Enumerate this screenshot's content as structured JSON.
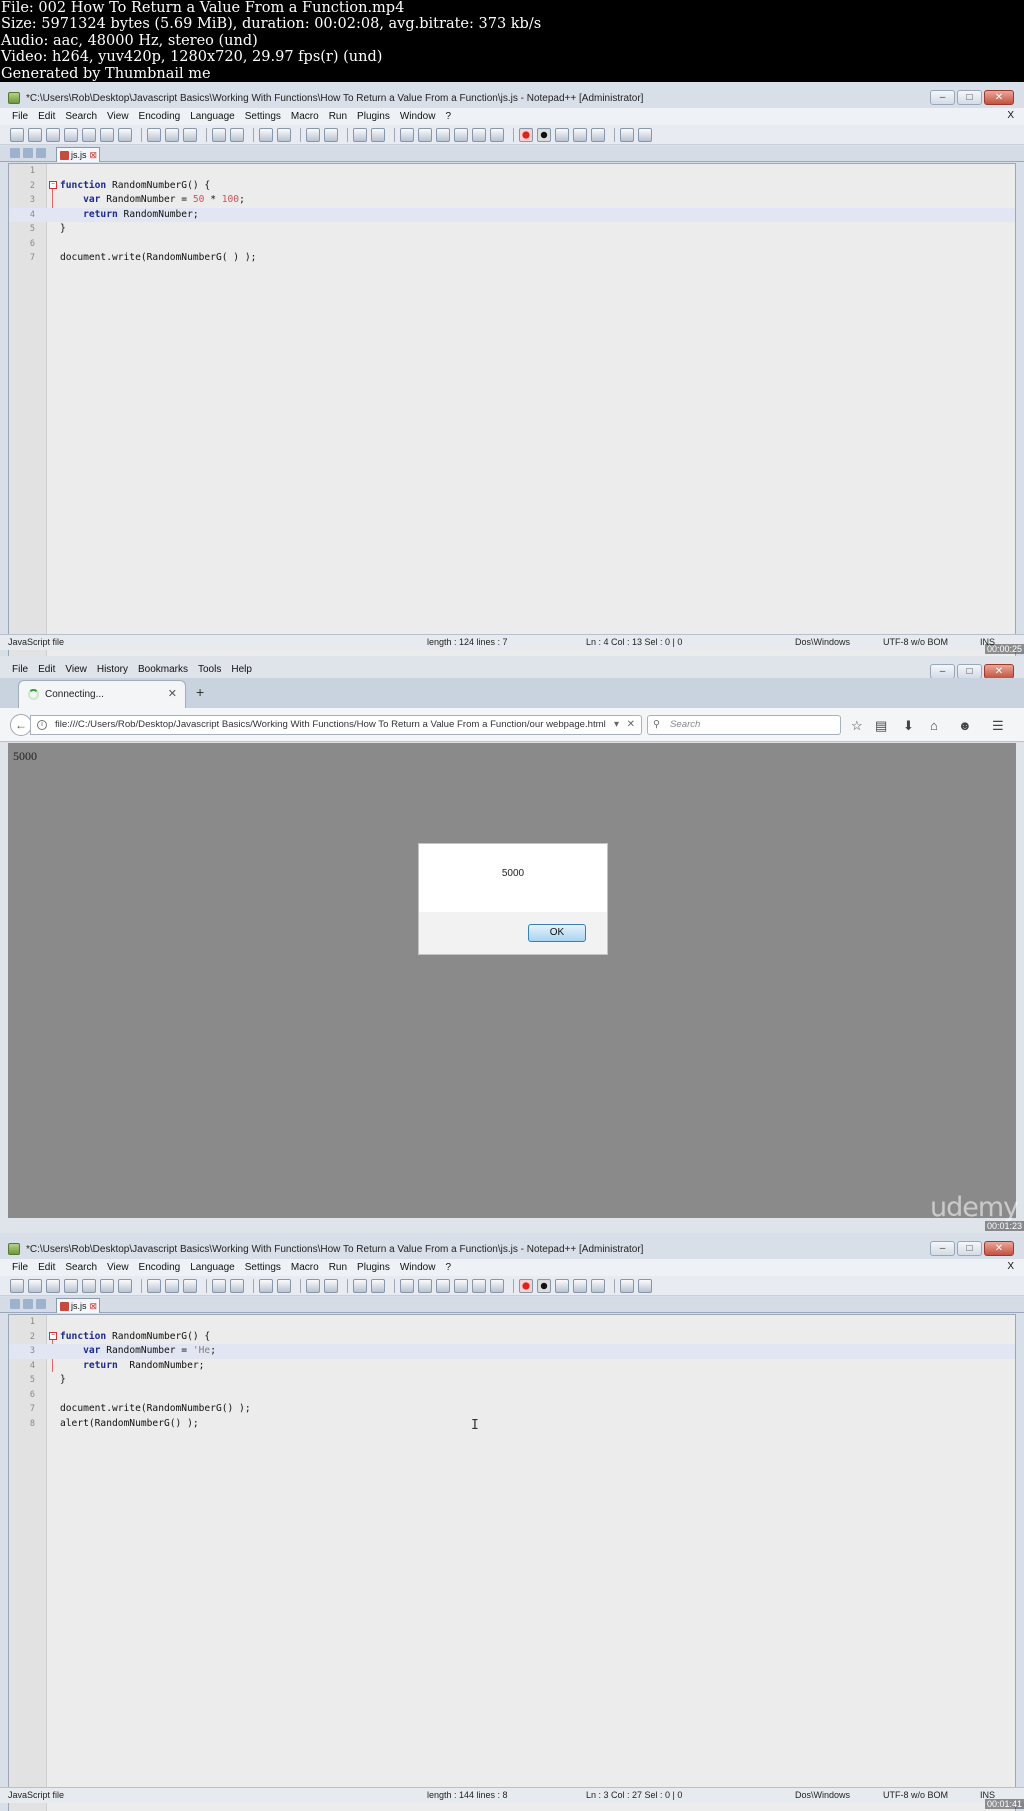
{
  "meta": {
    "lines": [
      "File: 002 How To Return a Value From a Function.mp4",
      "Size: 5971324 bytes (5.69 MiB), duration: 00:02:08, avg.bitrate: 373 kb/s",
      "Audio: aac, 48000 Hz, stereo (und)",
      "Video: h264, yuv420p, 1280x720, 29.97 fps(r) (und)",
      "Generated by Thumbnail me"
    ]
  },
  "frame1": {
    "title": "*C:\\Users\\Rob\\Desktop\\Javascript Basics\\Working With Functions\\How To Return a Value From a Function\\js.js - Notepad++ [Administrator]",
    "menu": [
      "File",
      "Edit",
      "Search",
      "View",
      "Encoding",
      "Language",
      "Settings",
      "Macro",
      "Run",
      "Plugins",
      "Window",
      "?"
    ],
    "menu_close": "X",
    "tab_label": "js.js",
    "code": {
      "l2a": "function",
      "l2b": " RandomNumberG() {",
      "l3a": "var",
      "l3b": " RandomNumber = ",
      "l3c": "50",
      "l3d": " * ",
      "l3e": "100",
      "l3f": ";",
      "l4a": "return",
      "l4b": " RandomNumber;",
      "l5": "}",
      "l7": "document.write(RandomNumberG( ) );"
    },
    "status": {
      "type": "JavaScript file",
      "length": "length : 124    lines : 7",
      "pos": "Ln : 4    Col : 13    Sel : 0 | 0",
      "eol": "Dos\\Windows",
      "enc": "UTF-8 w/o BOM",
      "ins": "INS"
    },
    "timestamp": "00:00:25"
  },
  "frame2": {
    "menu": [
      "File",
      "Edit",
      "View",
      "History",
      "Bookmarks",
      "Tools",
      "Help"
    ],
    "tab_label": "Connecting...",
    "tab_close": "✕",
    "new_tab": "+",
    "url": "file:///C:/Users/Rob/Desktop/Javascript Basics/Working With Functions/How To Return a Value From a Function/our webpage.html",
    "search_placeholder": "Search",
    "page_text": "5000",
    "dialog_message": "5000",
    "dialog_ok": "OK",
    "watermark": "udemy",
    "timestamp": "00:01:23"
  },
  "frame3": {
    "title": "*C:\\Users\\Rob\\Desktop\\Javascript Basics\\Working With Functions\\How To Return a Value From a Function\\js.js - Notepad++ [Administrator]",
    "menu": [
      "File",
      "Edit",
      "Search",
      "View",
      "Encoding",
      "Language",
      "Settings",
      "Macro",
      "Run",
      "Plugins",
      "Window",
      "?"
    ],
    "menu_close": "X",
    "tab_label": "js.js",
    "code": {
      "l2a": "function",
      "l2b": " RandomNumberG() {",
      "l3a": "var",
      "l3b": " RandomNumber = ",
      "l3c": "'He",
      "l3d": ";",
      "l4a": "return",
      "l4b": "  RandomNumber;",
      "l5": "}",
      "l7": "document.write(RandomNumberG() );",
      "l8": "alert(RandomNumberG() );"
    },
    "status": {
      "type": "JavaScript file",
      "length": "length : 144    lines : 8",
      "pos": "Ln : 3    Col : 27    Sel : 0 | 0",
      "eol": "Dos\\Windows",
      "enc": "UTF-8 w/o BOM",
      "ins": "INS"
    },
    "timestamp": "00:01:41"
  },
  "colors": {
    "keyword": "#1d2a8f",
    "number": "#d0505a",
    "highlight_line": "#e2e6f2"
  }
}
